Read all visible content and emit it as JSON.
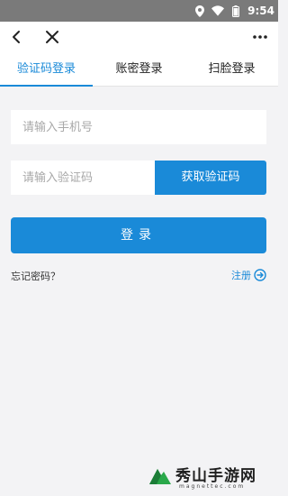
{
  "status_bar": {
    "time": "9:54",
    "icons": [
      "location-icon",
      "wifi-icon",
      "battery-icon"
    ]
  },
  "nav": {
    "icons": [
      "back-icon",
      "close-icon",
      "more-icon"
    ]
  },
  "tabs": [
    {
      "label": "验证码登录",
      "active": true
    },
    {
      "label": "账密登录",
      "active": false
    },
    {
      "label": "扫脸登录",
      "active": false
    }
  ],
  "form": {
    "phone_placeholder": "请输入手机号",
    "code_placeholder": "请输入验证码",
    "get_code_label": "获取验证码",
    "login_label": "登录"
  },
  "links": {
    "forgot": "忘记密码？",
    "register": "注册"
  },
  "watermark": {
    "text": "秀山手游网",
    "domain": "magnettec.com"
  },
  "colors": {
    "accent": "#1a8ad8",
    "status_bar": "#7a7a7a",
    "background": "#f3f3f5"
  }
}
